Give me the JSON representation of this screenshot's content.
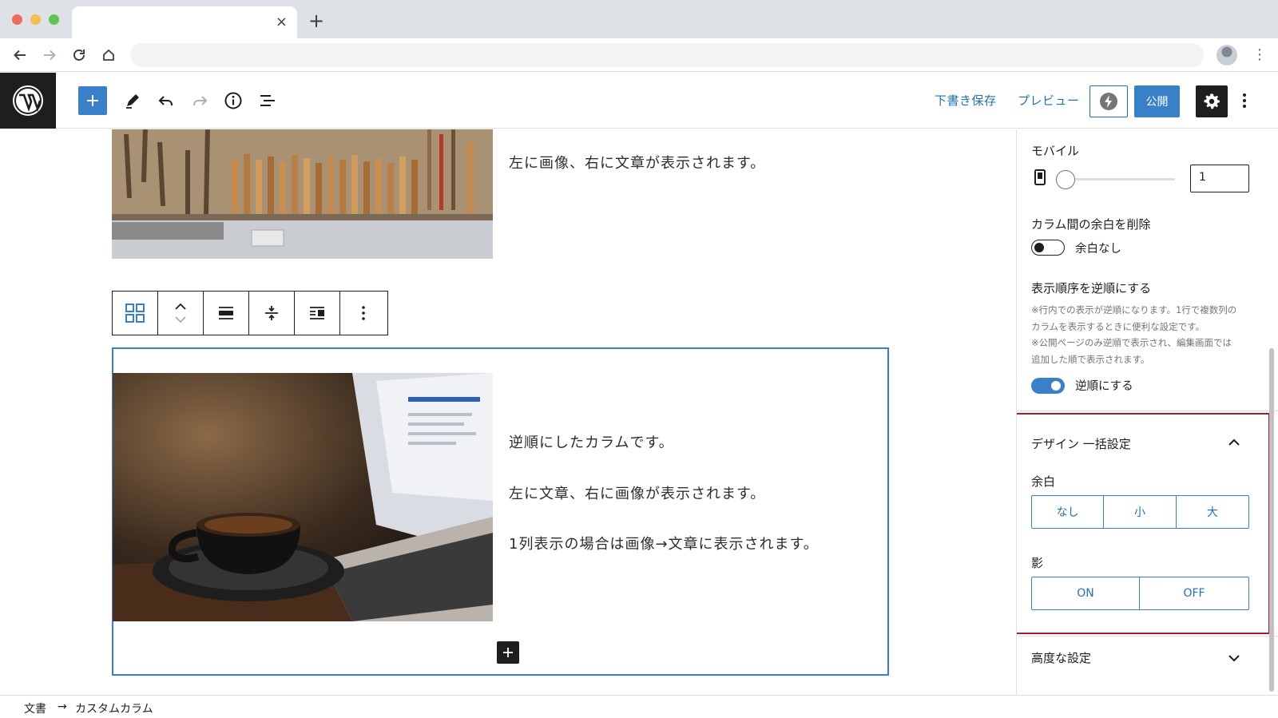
{
  "browser": {
    "tab_close": "×",
    "new_tab": "+"
  },
  "header": {
    "save_draft": "下書き保存",
    "preview": "プレビュー",
    "publish": "公開"
  },
  "canvas": {
    "column1_text": "左に画像、右に文章が表示されます。",
    "column2_texts": [
      "逆順にしたカラムです。",
      "左に文章、右に画像が表示されます。",
      "1列表示の場合は画像→文章に表示されます。"
    ]
  },
  "sidebar": {
    "mobile_label": "モバイル",
    "mobile_value": "1",
    "remove_gap_label": "カラム間の余白を削除",
    "remove_gap_toggle_label": "余白なし",
    "reverse_label": "表示順序を逆順にする",
    "reverse_help": [
      "※行内での表示が逆順になります。1行で複数列の",
      "カラムを表示するときに便利な設定です。",
      "※公開ページのみ逆順で表示され、編集画面では",
      "追加した順で表示されます。"
    ],
    "reverse_toggle_label": "逆順にする",
    "reverse_toggle_on": true,
    "design_panel_title": "デザイン 一括設定",
    "spacing_label": "余白",
    "spacing_options": [
      "なし",
      "小",
      "大"
    ],
    "shadow_label": "影",
    "shadow_options": [
      "ON",
      "OFF"
    ],
    "advanced_label": "高度な設定"
  },
  "footer": {
    "breadcrumb": [
      "文書",
      "カスタムカラム"
    ],
    "separator": "→"
  },
  "colors": {
    "accent": "#3a80c9",
    "highlight_border": "#a51d2a",
    "wp_dark": "#1e1e1e"
  }
}
